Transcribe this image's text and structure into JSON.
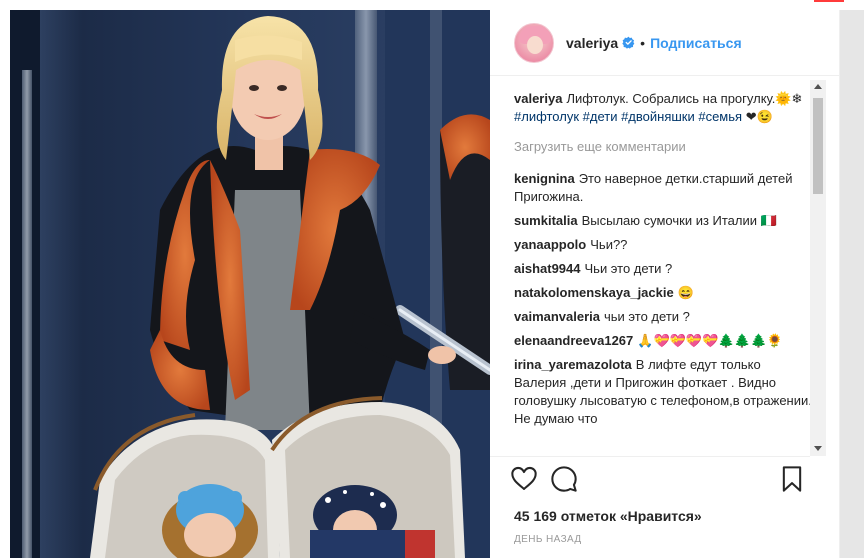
{
  "post": {
    "username": "valeriya",
    "separator": "•",
    "follow_label": "Подписаться",
    "caption": {
      "user": "valeriya",
      "text": "Лифтолук. Собрались на прогулку.",
      "emoji": "🌞❄",
      "tags": "#лифтолук #дети #двойняшки #семья",
      "tail": "❤😉"
    },
    "load_more": "Загрузить еще комментарии",
    "comments": [
      {
        "user": "kenignina",
        "text": "Это наверное детки.старший детей Пригожина."
      },
      {
        "user": "sumkitalia",
        "text": "Высылаю сумочки из Италии 🇮🇹"
      },
      {
        "user": "yanaappolo",
        "text": "Чьи??"
      },
      {
        "user": "aishat9944",
        "text": "Чьи это дети ?"
      },
      {
        "user": "natakolomenskaya_jackie",
        "text": "😄"
      },
      {
        "user": "vaimanvaleria",
        "text": "чьи это дети ?"
      },
      {
        "user": "elenaandreeva1267",
        "text": "🙏💝💝💝💝🌲🌲🌲🌻"
      },
      {
        "user": "irina_yaremazolota",
        "text": "В лифте едут только Валерия ,дети и Пригожин фоткает . Видно головушку лысоватую с телефоном,в отражении. Не думаю что"
      }
    ],
    "likes": "45 169 отметок «Нравится»",
    "time": "ДЕНЬ НАЗАД"
  },
  "icons": {
    "like": "heart-icon",
    "comment": "comment-icon",
    "save": "bookmark-icon",
    "verified": "verified-badge-icon"
  },
  "colors": {
    "link": "#3897f0",
    "hashtag": "#003569",
    "muted": "#999999",
    "verified": "#3897f0"
  }
}
